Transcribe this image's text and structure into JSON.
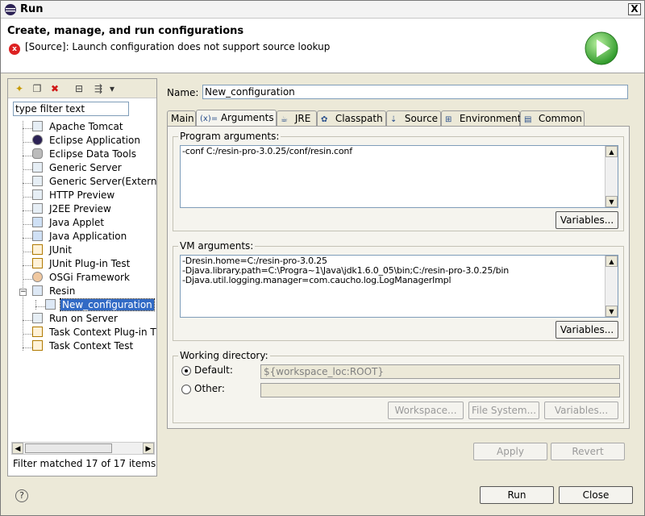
{
  "window": {
    "title": "Run",
    "close_glyph": "X"
  },
  "header": {
    "title": "Create, manage, and run configurations",
    "error_icon_glyph": "x",
    "error_message": "[Source]: Launch configuration does not support source lookup"
  },
  "left_toolbar": {
    "new_glyph": "✦",
    "duplicate_glyph": "❐",
    "delete_glyph": "✖",
    "collapse_glyph": "⊟",
    "filter_glyph": "⇶",
    "menu_glyph": "▾"
  },
  "filter": {
    "placeholder": "type filter text",
    "value": "type filter text"
  },
  "tree": {
    "items": [
      {
        "label": "Apache Tomcat",
        "icon": "server-icon"
      },
      {
        "label": "Eclipse Application",
        "icon": "eclipse-icon"
      },
      {
        "label": "Eclipse Data Tools",
        "icon": "database-icon"
      },
      {
        "label": "Generic Server",
        "icon": "server-icon"
      },
      {
        "label": "Generic Server(Externa",
        "icon": "server-icon"
      },
      {
        "label": "HTTP Preview",
        "icon": "server-icon"
      },
      {
        "label": "J2EE Preview",
        "icon": "server-icon"
      },
      {
        "label": "Java Applet",
        "icon": "applet-icon"
      },
      {
        "label": "Java Application",
        "icon": "java-app-icon"
      },
      {
        "label": "JUnit",
        "icon": "junit-icon"
      },
      {
        "label": "JUnit Plug-in Test",
        "icon": "junit-plugin-icon"
      },
      {
        "label": "OSGi Framework",
        "icon": "osgi-icon"
      },
      {
        "label": "Resin",
        "icon": "resin-icon"
      },
      {
        "label": "New_configuration",
        "icon": "config-icon"
      },
      {
        "label": "Run on Server",
        "icon": "server-icon"
      },
      {
        "label": "Task Context Plug-in T",
        "icon": "task-plugin-icon"
      },
      {
        "label": "Task Context Test",
        "icon": "task-test-icon"
      }
    ],
    "expander_glyph": "−"
  },
  "filter_status": "Filter matched 17 of 17 items",
  "name_field": {
    "label": "Name:",
    "value": "New_configuration"
  },
  "tabs": [
    {
      "label": "Main",
      "icon": "main-tab-icon"
    },
    {
      "label": "Arguments",
      "icon": "arguments-tab-icon"
    },
    {
      "label": "JRE",
      "icon": "jre-tab-icon"
    },
    {
      "label": "Classpath",
      "icon": "classpath-tab-icon"
    },
    {
      "label": "Source",
      "icon": "source-tab-icon"
    },
    {
      "label": "Environment",
      "icon": "environment-tab-icon"
    },
    {
      "label": "Common",
      "icon": "common-tab-icon"
    }
  ],
  "tab_icon_glyphs": {
    "arguments": "(x)=",
    "jre": "☕",
    "classpath": "✿",
    "source": "⇣",
    "environment": "⊞",
    "common": "▤"
  },
  "program_args": {
    "label": "Program arguments:",
    "value": "-conf C:/resin-pro-3.0.25/conf/resin.conf",
    "variables_label": "Variables..."
  },
  "vm_args": {
    "label": "VM arguments:",
    "value": "-Dresin.home=C:/resin-pro-3.0.25\n-Djava.library.path=C:\\Progra~1\\Java\\jdk1.6.0_05\\bin;C:/resin-pro-3.0.25/bin\n-Djava.util.logging.manager=com.caucho.log.LogManagerImpl",
    "variables_label": "Variables..."
  },
  "working_dir": {
    "label": "Working directory:",
    "default_label": "Default:",
    "default_value": "${workspace_loc:ROOT}",
    "other_label": "Other:",
    "other_value": "",
    "workspace_button": "Workspace...",
    "filesystem_button": "File System...",
    "variables_button": "Variables..."
  },
  "scroll_glyphs": {
    "up": "▲",
    "down": "▼",
    "left": "◀",
    "right": "▶"
  },
  "actions": {
    "apply": "Apply",
    "revert": "Revert",
    "run": "Run",
    "close": "Close"
  },
  "help_glyph": "?"
}
